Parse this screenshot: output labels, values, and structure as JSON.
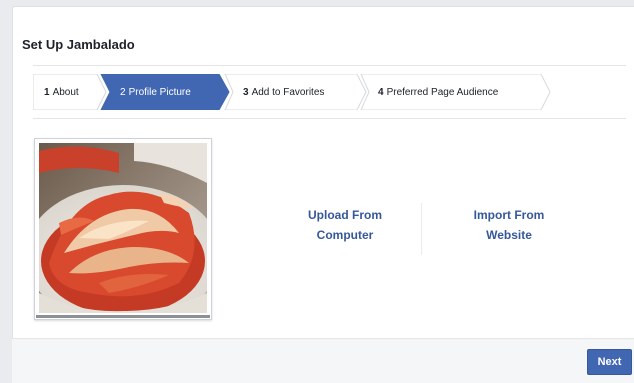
{
  "dialog": {
    "title": "Set Up Jambalado"
  },
  "steps": [
    {
      "num": "1",
      "label": "About",
      "active": false
    },
    {
      "num": "2",
      "label": "Profile Picture",
      "active": true
    },
    {
      "num": "3",
      "label": "Add to Favorites",
      "active": false
    },
    {
      "num": "4",
      "label": "Preferred Page Audience",
      "active": false
    }
  ],
  "profile_picture": {
    "upload_line1": "Upload From",
    "upload_line2": "Computer",
    "import_line1": "Import From",
    "import_line2": "Website"
  },
  "footer": {
    "next_label": "Next"
  },
  "colors": {
    "accent": "#4267b2",
    "link": "#365899"
  }
}
